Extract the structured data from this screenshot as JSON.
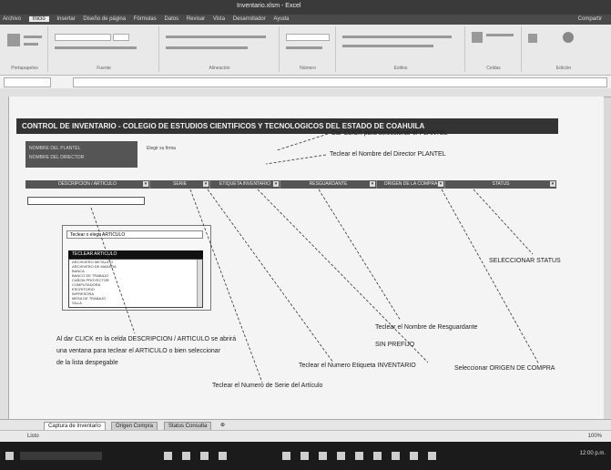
{
  "window": {
    "title": "Inventario.xlsm - Excel"
  },
  "ribbon_tabs": [
    "Archivo",
    "Inicio",
    "Insertar",
    "Diseño de página",
    "Fórmulas",
    "Datos",
    "Revisar",
    "Vista",
    "Desarrollador",
    "Ayuda"
  ],
  "ribbon_active": "Inicio",
  "account": "Compartir",
  "ribbon_groups": [
    "Portapapeles",
    "Fuente",
    "Alineación",
    "Número",
    "Estilos",
    "Celdas",
    "Edición"
  ],
  "sheet": {
    "banner": "CONTROL DE INVENTARIO - COLEGIO DE ESTUDIOS CIENTIFICOS Y TECNOLOGICOS DEL ESTADO DE COAHUILA",
    "plantel_label_1": "NOMBRE DEL PLANTEL",
    "plantel_label_2": "NOMBRE DEL DIRECTOR",
    "director_text": "Elegir su firma",
    "headers": [
      "DESCRIPCION / ARTICULO",
      "SERIE",
      "ETIQUETA INVENTARIO",
      "RESGUARDANTE",
      "ORIGEN DE LA COMPRA",
      "STATUS"
    ]
  },
  "popup": {
    "combo_value": "Teclear o elegir ARTICULO",
    "list_header": "TECLEAR ARTICULO",
    "items": [
      "ARCHIVERO METALICO",
      "ARCHIVERO DE MADERA",
      "BANCA",
      "BANCO DE TRABAJO",
      "CAÑON PROYECTOR",
      "COMPUTADORA",
      "ESCRITORIO",
      "IMPRESORA",
      "MESA DE TRABAJO",
      "SILLA"
    ]
  },
  "annotations": {
    "a1": "Dar CLICK para seleccionar el PLANTEL",
    "a2": "Teclear el Nombre del Director PLANTEL",
    "a3": "SELECCIONAR STATUS",
    "a4": "Teclear el Nombre de Resguardante",
    "a5": "SIN PREFIJO",
    "a6a": "Al dar CLICK en la celda DESCRIPCION / ARTICULO se abrirá",
    "a6b": "una ventana para teclear el ARTICULO o bien seleccionar",
    "a6c": "de la lista despegable",
    "a7": "Teclear el Numero Etiqueta INVENTARIO",
    "a8": "Seleccionar ORIGEN DE COMPRA",
    "a9": "Teclear el Numero de Serie del Artículo"
  },
  "sheet_tabs": [
    "Captura de Inventario",
    "Origen Compra",
    "Status Consulta"
  ],
  "status_bar": {
    "left": "Listo",
    "zoom": "100%"
  },
  "clock": "12:00 p.m."
}
